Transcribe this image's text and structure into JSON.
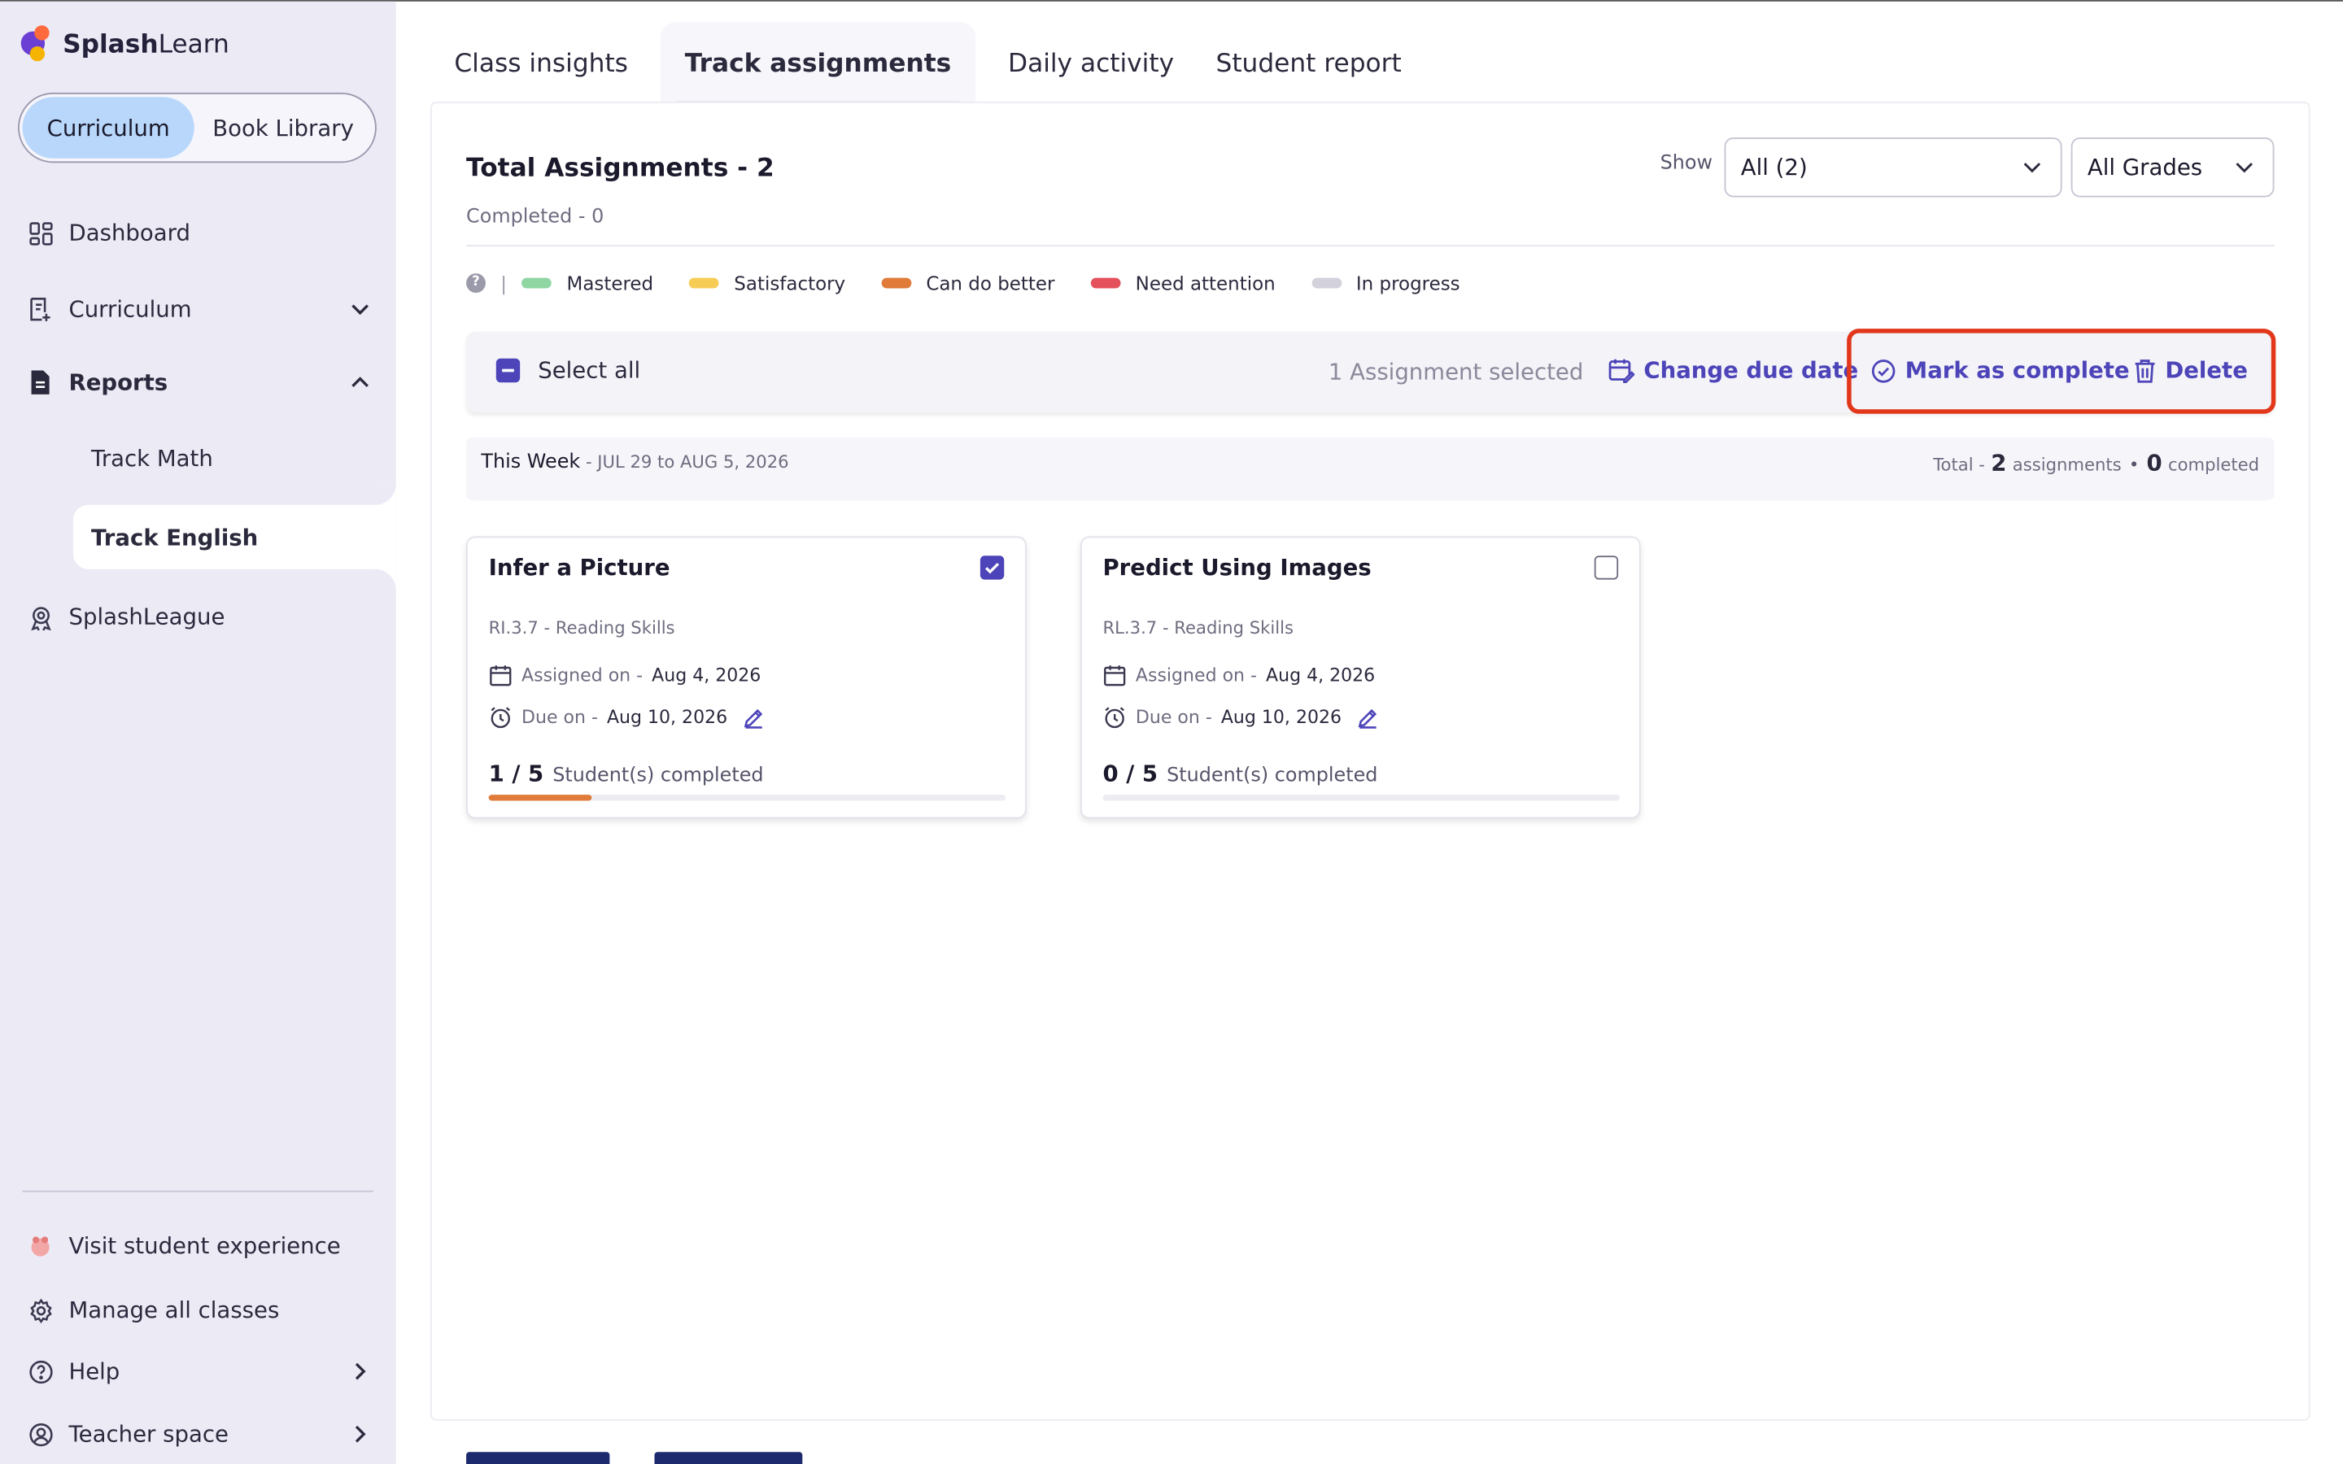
{
  "brand": {
    "name_bold": "Splash",
    "name_regular": "Learn"
  },
  "sidebar": {
    "segment": {
      "active": "Curriculum",
      "other": "Book Library"
    },
    "items": {
      "dashboard": "Dashboard",
      "curriculum": "Curriculum",
      "reports": "Reports",
      "track_math": "Track Math",
      "track_english": "Track English",
      "splashleague": "SplashLeague"
    },
    "bottom": {
      "visit": "Visit student experience",
      "manage": "Manage all classes",
      "help": "Help",
      "teacher": "Teacher space"
    }
  },
  "tabs": [
    "Class insights",
    "Track assignments",
    "Daily activity",
    "Student report"
  ],
  "header": {
    "total": "Total Assignments - 2",
    "completed": "Completed - 0",
    "show_label": "Show",
    "filter_all": "All (2)",
    "filter_grades": "All Grades"
  },
  "legend": [
    {
      "label": "Mastered",
      "color": "#8fd6a3"
    },
    {
      "label": "Satisfactory",
      "color": "#f7cc55"
    },
    {
      "label": "Can do better",
      "color": "#e07b39"
    },
    {
      "label": "Need attention",
      "color": "#e5505d"
    },
    {
      "label": "In progress",
      "color": "#d3d2dc"
    }
  ],
  "legend_help": "?",
  "legend_sep": "|",
  "actions": {
    "select_all": "Select all",
    "selected": "1 Assignment selected",
    "change_due": "Change due date",
    "mark_complete": "Mark as complete",
    "delete": "Delete"
  },
  "week": {
    "title": "This Week",
    "range": " - JUL 29 to AUG 5, 2026",
    "total_prefix": "Total -",
    "total_count": "2",
    "total_unit": "assignments",
    "bullet": "•",
    "completed_count": "0",
    "completed_unit": "completed"
  },
  "cards": [
    {
      "title": "Infer a Picture",
      "standard": "RI.3.7 - Reading Skills",
      "assigned_label": "Assigned on -",
      "assigned": "Aug 4, 2026",
      "due_label": "Due on -",
      "due": "Aug 10, 2026",
      "progress": "1 / 5",
      "progress_label": "Student(s) completed",
      "fraction": 0.2,
      "checked": true
    },
    {
      "title": "Predict Using Images",
      "standard": "RL.3.7 - Reading Skills",
      "assigned_label": "Assigned on -",
      "assigned": "Aug 4, 2026",
      "due_label": "Due on -",
      "due": "Aug 10, 2026",
      "progress": "0 / 5",
      "progress_label": "Student(s) completed",
      "fraction": 0,
      "checked": false
    }
  ],
  "colors": {
    "accent": "#4c44b8",
    "highlight": "#e2371b",
    "sidebar": "#eceaf5"
  }
}
